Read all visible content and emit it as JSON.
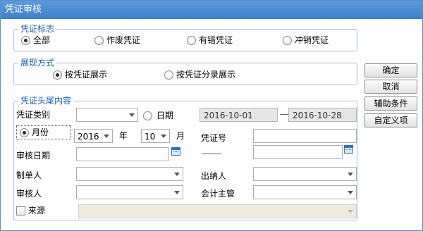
{
  "window": {
    "title": "凭证审核"
  },
  "group_mark": {
    "legend": "凭证标志",
    "options": [
      "全部",
      "作废凭证",
      "有错凭证",
      "冲销凭证"
    ],
    "selected": "全部"
  },
  "group_display": {
    "legend": "展现方式",
    "options": [
      "按凭证展示",
      "按凭证分录展示"
    ],
    "selected": "按凭证展示"
  },
  "group_header": {
    "legend": "凭证头尾内容",
    "voucher_type_label": "凭证类别",
    "voucher_type_value": "",
    "date_label": "日期",
    "date_from": "2016-10-01",
    "date_to": "2016-10-28",
    "month_label": "月份",
    "year_value": "2016",
    "year_unit": "年",
    "month_value": "10",
    "month_unit": "月",
    "voucher_no_label": "凭证号",
    "voucher_no_from": "",
    "voucher_no_to": "",
    "audit_date_label": "审核日期",
    "audit_date_from": "",
    "audit_date_to": "",
    "maker_label": "制单人",
    "maker_value": "",
    "cashier_label": "出纳人",
    "cashier_value": "",
    "auditor_label": "审核人",
    "auditor_value": "",
    "supervisor_label": "会计主管",
    "supervisor_value": "",
    "source_label": "来源",
    "source_value": "",
    "period_selected": "月份"
  },
  "buttons": {
    "ok": "确定",
    "cancel": "取消",
    "aux": "辅助条件",
    "custom": "自定义项"
  }
}
